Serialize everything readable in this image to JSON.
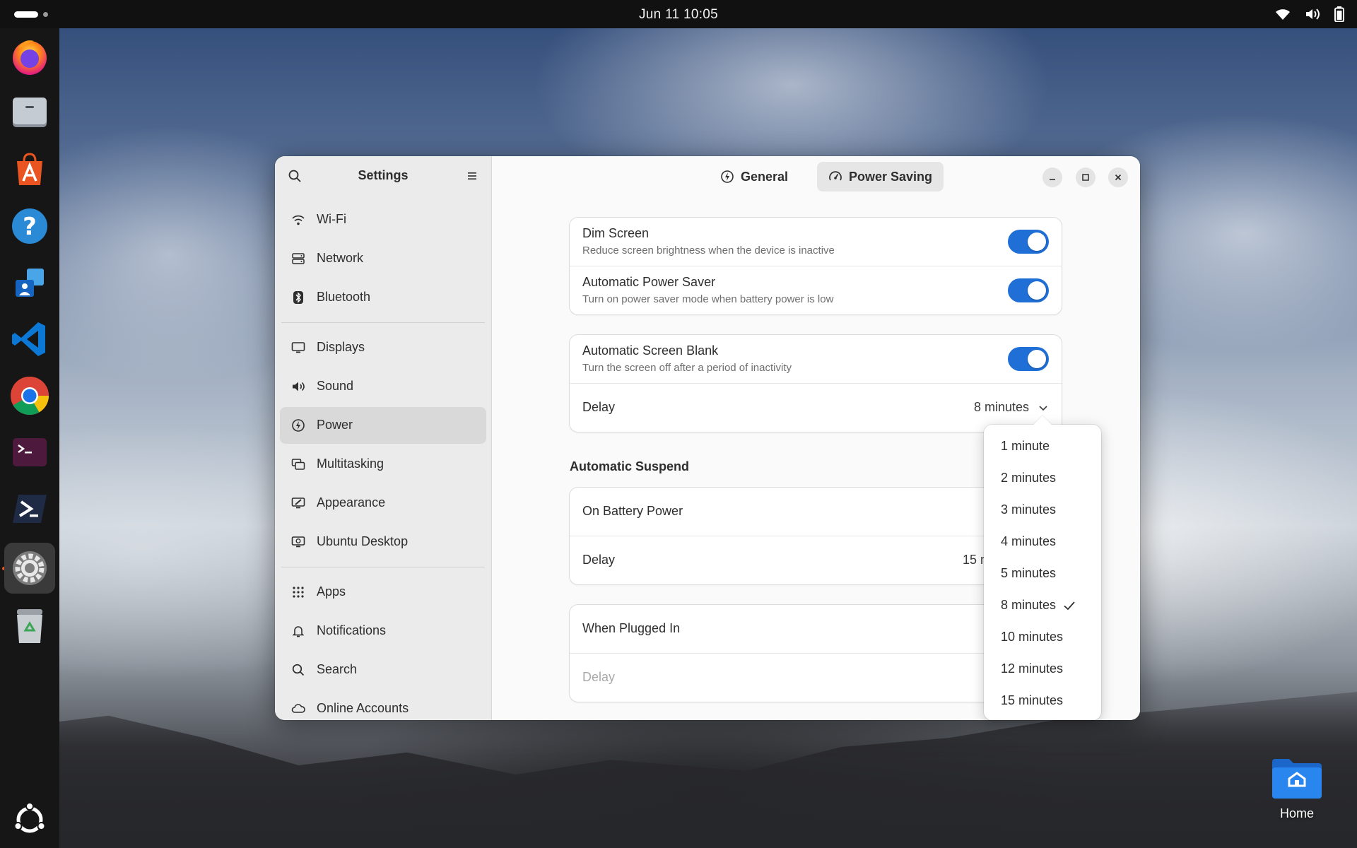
{
  "topbar": {
    "clock": "Jun 11  10:05",
    "tray_icons": [
      "wifi-icon",
      "volume-icon",
      "battery-icon"
    ]
  },
  "dock": {
    "apps": [
      "firefox",
      "files",
      "app-center",
      "help",
      "remote-desktop",
      "vs-code",
      "chrome",
      "terminal",
      "powershell",
      "settings",
      "trash"
    ],
    "active_app": "settings",
    "bottom": "ubuntu-show-apps"
  },
  "desktop": {
    "home_label": "Home"
  },
  "window": {
    "sidebar": {
      "title": "Settings",
      "groups": [
        [
          {
            "label": "Wi-Fi",
            "icon": "wifi-icon"
          },
          {
            "label": "Network",
            "icon": "network-icon"
          },
          {
            "label": "Bluetooth",
            "icon": "bluetooth-icon"
          }
        ],
        [
          {
            "label": "Displays",
            "icon": "display-icon"
          },
          {
            "label": "Sound",
            "icon": "speaker-icon"
          },
          {
            "label": "Power",
            "icon": "power-icon",
            "selected": true
          },
          {
            "label": "Multitasking",
            "icon": "multitasking-icon"
          },
          {
            "label": "Appearance",
            "icon": "appearance-icon"
          },
          {
            "label": "Ubuntu Desktop",
            "icon": "ubuntu-desktop-icon"
          }
        ],
        [
          {
            "label": "Apps",
            "icon": "apps-grid-icon"
          },
          {
            "label": "Notifications",
            "icon": "bell-icon"
          },
          {
            "label": "Search",
            "icon": "search-icon"
          },
          {
            "label": "Online Accounts",
            "icon": "cloud-icon"
          }
        ]
      ]
    },
    "tabs": [
      {
        "label": "General",
        "icon": "power-icon",
        "active": false
      },
      {
        "label": "Power Saving",
        "icon": "gauge-icon",
        "active": true
      }
    ],
    "cards": {
      "dim": {
        "title": "Dim Screen",
        "subtitle": "Reduce screen brightness when the device is inactive",
        "enabled": true
      },
      "power_saver": {
        "title": "Automatic Power Saver",
        "subtitle": "Turn on power saver mode when battery power is low",
        "enabled": true
      },
      "blank": {
        "title": "Automatic Screen Blank",
        "subtitle": "Turn the screen off after a period of inactivity",
        "enabled": true
      },
      "blank_delay": {
        "title": "Delay",
        "value": "8 minutes"
      },
      "suspend_title": "Automatic Suspend",
      "battery": {
        "title": "On Battery Power",
        "delay_title": "Delay",
        "delay_value_partial": "15 m"
      },
      "plugged": {
        "title": "When Plugged In",
        "delay_title": "Delay"
      }
    },
    "popover": {
      "options": [
        "1 minute",
        "2 minutes",
        "3 minutes",
        "4 minutes",
        "5 minutes",
        "8 minutes",
        "10 minutes",
        "12 minutes",
        "15 minutes"
      ],
      "selected_index": 5
    }
  },
  "colors": {
    "accent": "#1f6fd6",
    "ubuntu_orange": "#e95420"
  }
}
